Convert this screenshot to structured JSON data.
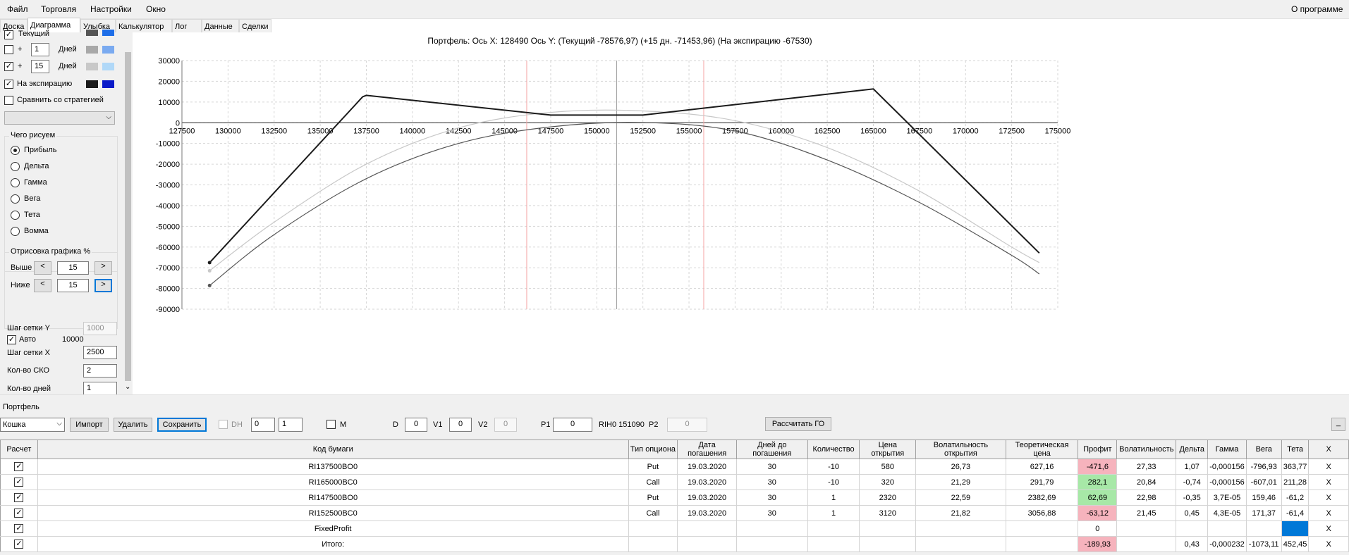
{
  "menu": {
    "items": [
      "Файл",
      "Торговля",
      "Настройки",
      "Окно"
    ],
    "about": "О программе"
  },
  "tabs": [
    "Доска",
    "Диаграмма",
    "Улыбка",
    "Калькулятор",
    "Лог",
    "Данные",
    "Сделки"
  ],
  "left": {
    "current_label": "Текущий",
    "plus": "+",
    "days_unit": "Дней",
    "days1": "1",
    "days2": "15",
    "expiry_label": "На экспирацию",
    "compare_label": "Сравнить со стратегией",
    "draw_group_title": "Чего рисуем",
    "draw_options": [
      "Прибыль",
      "Дельта",
      "Гамма",
      "Вега",
      "Тета",
      "Вомма"
    ],
    "percent_group_title": "Отрисовка графика %",
    "above_label": "Выше",
    "below_label": "Ниже",
    "above_value": "15",
    "below_value": "15",
    "btn_left": "<",
    "btn_right": ">",
    "grid_y_label": "Шаг сетки Y",
    "grid_y_value": "1000",
    "auto_label": "Авто",
    "auto_value": "10000",
    "grid_x_label": "Шаг сетки X",
    "grid_x_value": "2500",
    "sko_label": "Кол-во СКО",
    "sko_value": "2",
    "days_count_label": "Кол-во дней",
    "days_count_value": "1",
    "swatch_colors": {
      "current": [
        "#555555",
        "#1e6ee8"
      ],
      "days1": [
        "#a8a8a8",
        "#7aaaf0"
      ],
      "days2": [
        "#c8c8c8",
        "#b0d8f8"
      ],
      "expiry": [
        "#1a1a1a",
        "#0a1ac8"
      ]
    }
  },
  "chart_data": {
    "type": "line",
    "title": "Портфель: Ось X: 128490 Ось Y: (Текущий -78576,97) (+15 дн. -71453,96) (На экспирацию -67530)",
    "xlim": [
      127500,
      175000
    ],
    "ylim": [
      -90000,
      30000
    ],
    "x_ticks": [
      127500,
      130000,
      132500,
      135000,
      137500,
      140000,
      142500,
      145000,
      147500,
      150000,
      152500,
      155000,
      157500,
      160000,
      162500,
      165000,
      167500,
      170000,
      172500,
      175000
    ],
    "y_ticks": [
      30000,
      20000,
      10000,
      0,
      -10000,
      -20000,
      -30000,
      -40000,
      -50000,
      -60000,
      -70000,
      -80000,
      -90000
    ],
    "grid": true,
    "vlines": [
      {
        "x": 146200,
        "color": "#f4a6a6"
      },
      {
        "x": 151080,
        "color": "#9a9a9a"
      },
      {
        "x": 155800,
        "color": "#f4a6a6"
      }
    ],
    "series": [
      {
        "color": "#1a1a1a",
        "width": 2,
        "x": [
          129000,
          137300,
          137500,
          147500,
          152500,
          165000,
          174000
        ],
        "y": [
          -67530,
          12500,
          13200,
          3700,
          3700,
          16300,
          -62900
        ]
      },
      {
        "color": "#c8c8c8",
        "width": 1.2,
        "x": [
          129000,
          132500,
          137500,
          142500,
          147500,
          152500,
          157500,
          162500,
          167500,
          172500,
          174000
        ],
        "y": [
          -71450,
          -48000,
          -20000,
          -2500,
          5000,
          5700,
          1000,
          -12000,
          -33000,
          -60000,
          -67500
        ]
      },
      {
        "color": "#555555",
        "width": 1.2,
        "x": [
          129000,
          132500,
          137500,
          142500,
          147500,
          152500,
          157500,
          162500,
          167500,
          172500,
          174000
        ],
        "y": [
          -78580,
          -54000,
          -27000,
          -10000,
          -2000,
          100,
          -4000,
          -18000,
          -38500,
          -64000,
          -73000
        ]
      }
    ]
  },
  "portfolio": {
    "title": "Портфель",
    "account": "Кошка",
    "import": "Импорт",
    "delete": "Удалить",
    "save": "Сохранить",
    "dh_label": "DH",
    "dh_val1": "0",
    "dh_val2": "1",
    "m_label": "M",
    "d_label": "D",
    "d_value": "0",
    "v1_label": "V1",
    "v1_value": "0",
    "v2_label": "V2",
    "v2_value": "0",
    "p1_label": "P1",
    "p1_value": "0",
    "rih_label": "RIH0 151090",
    "p2_label": "P2",
    "p2_value": "0",
    "calc_go": "Рассчитать ГО",
    "minimize": "_"
  },
  "grid": {
    "headers": [
      "Расчет",
      "Код бумаги",
      "Тип опциона",
      "Дата погашения",
      "Дней до погашения",
      "Количество",
      "Цена открытия",
      "Волатильность открытия",
      "Теоретическая цена",
      "Профит",
      "Волатильность",
      "Дельта",
      "Гамма",
      "Вега",
      "Тета",
      "X"
    ],
    "check_mark": "✓",
    "rows": [
      {
        "code": "RI137500BO0",
        "type": "Put",
        "date": "19.03.2020",
        "days": "30",
        "qty": "-10",
        "open_price": "580",
        "open_vol": "26,73",
        "theo": "627,16",
        "profit": "-471,6",
        "profit_sign": "neg",
        "vol": "27,33",
        "delta": "1,07",
        "gamma": "-0,000156",
        "vega": "-796,93",
        "theta": "363,77",
        "x": "X"
      },
      {
        "code": "RI165000BC0",
        "type": "Call",
        "date": "19.03.2020",
        "days": "30",
        "qty": "-10",
        "open_price": "320",
        "open_vol": "21,29",
        "theo": "291,79",
        "profit": "282,1",
        "profit_sign": "pos",
        "vol": "20,84",
        "delta": "-0,74",
        "gamma": "-0,000156",
        "vega": "-607,01",
        "theta": "211,28",
        "x": "X"
      },
      {
        "code": "RI147500BO0",
        "type": "Put",
        "date": "19.03.2020",
        "days": "30",
        "qty": "1",
        "open_price": "2320",
        "open_vol": "22,59",
        "theo": "2382,69",
        "profit": "62,69",
        "profit_sign": "pos",
        "vol": "22,98",
        "delta": "-0,35",
        "gamma": "3,7E-05",
        "vega": "159,46",
        "theta": "-61,2",
        "x": "X"
      },
      {
        "code": "RI152500BC0",
        "type": "Call",
        "date": "19.03.2020",
        "days": "30",
        "qty": "1",
        "open_price": "3120",
        "open_vol": "21,82",
        "theo": "3056,88",
        "profit": "-63,12",
        "profit_sign": "neg",
        "vol": "21,45",
        "delta": "0,45",
        "gamma": "4,3E-05",
        "vega": "171,37",
        "theta": "-61,4",
        "x": "X"
      },
      {
        "code": "FixedProfit",
        "type": "",
        "date": "",
        "days": "",
        "qty": "",
        "open_price": "",
        "open_vol": "",
        "theo": "",
        "profit": "0",
        "profit_sign": "",
        "vol": "",
        "delta": "",
        "gamma": "",
        "vega": "",
        "theta": "",
        "theta_sign": "blue",
        "x": "X"
      },
      {
        "code": "Итого:",
        "type": "",
        "date": "",
        "days": "",
        "qty": "",
        "open_price": "",
        "open_vol": "",
        "theo": "",
        "profit": "-189,93",
        "profit_sign": "neg",
        "vol": "",
        "delta": "0,43",
        "gamma": "-0,000232",
        "vega": "-1073,11",
        "theta": "452,45",
        "x": "X"
      }
    ]
  }
}
